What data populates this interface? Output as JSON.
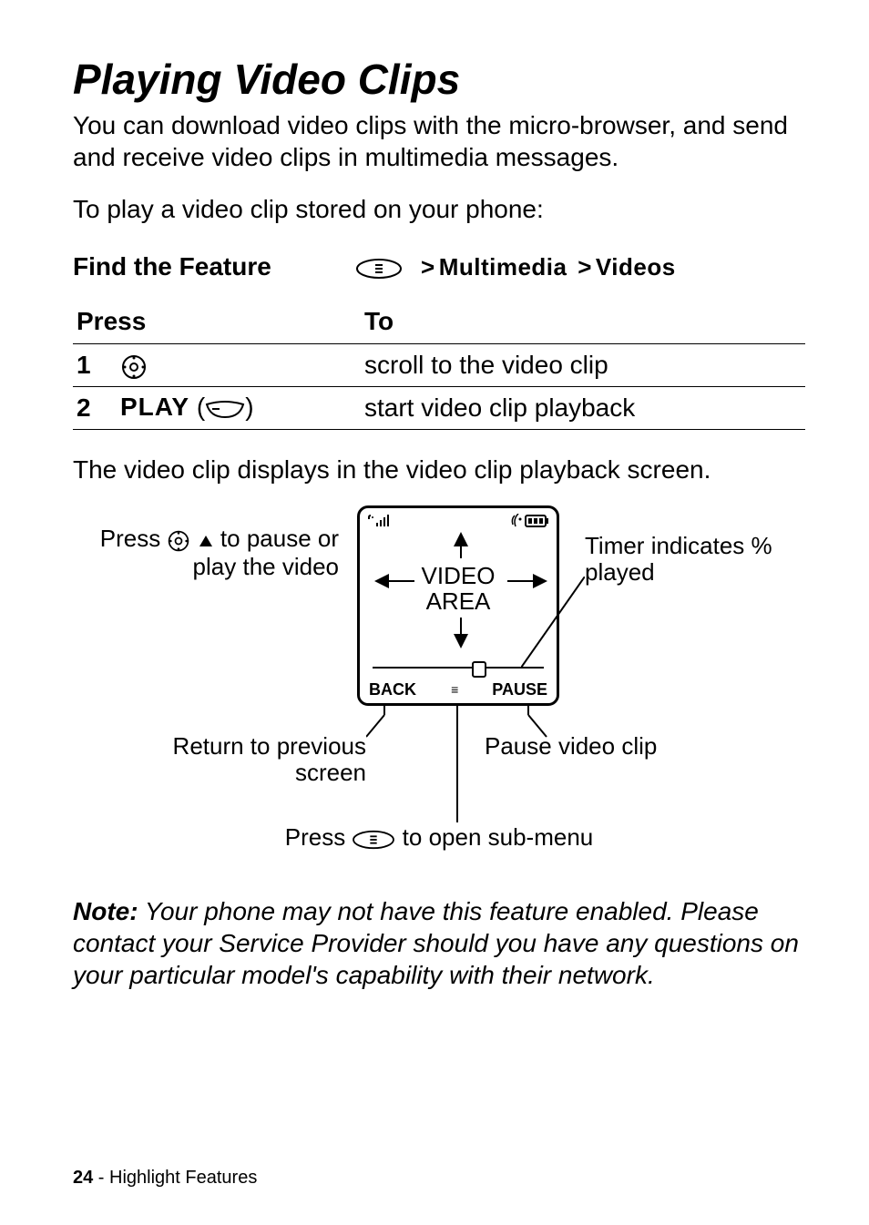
{
  "title": "Playing Video Clips",
  "intro1": "You can download video clips with the micro-browser, and send and receive video clips in multimedia messages.",
  "intro2": "To play a video clip stored on your phone:",
  "find_feature": {
    "label": "Find the Feature",
    "gt": ">",
    "path1": "Multimedia",
    "path2": "Videos"
  },
  "table": {
    "h_press": "Press",
    "h_to": "To",
    "rows": [
      {
        "num": "1",
        "press_text": "",
        "to": "scroll to the video clip"
      },
      {
        "num": "2",
        "press_text": "PLAY",
        "to": "start video clip playback"
      }
    ]
  },
  "after_table": "The video clip displays in the video clip playback screen.",
  "diagram": {
    "status_left": "ıllı",
    "status_right": "◎",
    "video_area_line1": "VIDEO",
    "video_area_line2": "AREA",
    "soft_left": "BACK",
    "soft_right": "PAUSE",
    "soft_mid": "≡",
    "callout_pause_play_a": "Press ",
    "callout_pause_play_b": " to pause or play the video",
    "callout_timer": "Timer indicates % played",
    "callout_back": "Return to previous screen",
    "callout_pause": "Pause video clip",
    "callout_submenu_a": "Press ",
    "callout_submenu_b": " to open sub-menu"
  },
  "note": {
    "label": "Note:",
    "text": " Your phone may not have this feature enabled. Please contact your Service Provider should you have any questions on your particular model's capability with their network."
  },
  "footer": {
    "page": "24",
    "sep": " - ",
    "section": "Highlight Features"
  }
}
